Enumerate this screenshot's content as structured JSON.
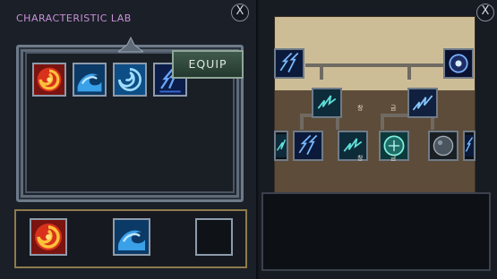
{
  "lab": {
    "title": "CHARACTERISTIC LAB",
    "close_label": "X",
    "equip_label": "EQUIP",
    "inventory": [
      "fire-swirl",
      "water-wave",
      "whirlpool",
      "lightning-spark"
    ],
    "equipped": [
      "fire-swirl",
      "water-wave",
      "empty"
    ]
  },
  "tree": {
    "close_label": "X",
    "node_labels": [
      "창",
      "금",
      "창",
      "금"
    ]
  },
  "colors": {
    "title": "#c88fd6",
    "tray_border": "#8d7a4b",
    "equip_button": "#3f5a4c"
  }
}
